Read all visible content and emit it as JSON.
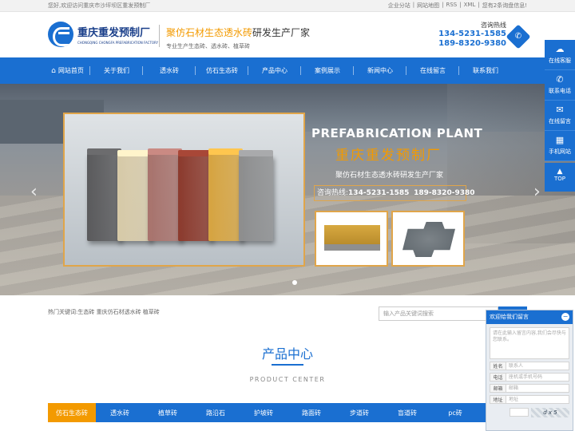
{
  "topbar": {
    "welcome": "您好,欢迎访问重庆市沙坪坝区重发预制厂",
    "links": [
      "企业分站",
      "|",
      "网站地图",
      "|",
      "RSS",
      "|",
      "XML",
      "|",
      "您有2条询盘信息!"
    ]
  },
  "header": {
    "logo_cn": "重庆重发预制厂",
    "logo_en": "CHONGQING CHONGFA PREFABRICATION FACTORY",
    "slogan_hl": "聚仿石材生态透水砖",
    "slogan_rest": "研发生产厂家",
    "slogan_sub": "专业生产生态砖、透水砖、植草砖",
    "hotline_title": "咨询热线",
    "hotline_1": "134-5231-1585",
    "hotline_2": "189-8320-9380",
    "phone_icon": "phone-icon"
  },
  "nav": {
    "items": [
      {
        "label": "网站首页"
      },
      {
        "label": "关于我们"
      },
      {
        "label": "透水砖"
      },
      {
        "label": "仿石生态砖"
      },
      {
        "label": "产品中心"
      },
      {
        "label": "案例展示"
      },
      {
        "label": "新闻中心"
      },
      {
        "label": "在线留言"
      },
      {
        "label": "联系我们"
      }
    ]
  },
  "banner": {
    "title_en": "PREFABRICATION PLANT",
    "title_cn": "重庆重发预制厂",
    "subtitle": "聚仿石材生态透水砖研发生产厂家",
    "phone_label": "咨询热线:",
    "phone_1": "134-5231-1585",
    "phone_2": "189-8320-9380",
    "prev": "‹",
    "next": "›",
    "brick_colors": [
      "#5a5a5c",
      "#d8cba9",
      "#a8736d",
      "#8c3b2e",
      "#d7a542",
      "#8d8e8f"
    ]
  },
  "search": {
    "hot_keywords": "热门关键词:生态砖 重庆仿石材透水砖 植草砖",
    "placeholder": "输入产品关键词搜索"
  },
  "products": {
    "title": "产品中心",
    "title_en": "PRODUCT CENTER",
    "tabs": [
      "仿石生态砖",
      "透水砖",
      "植草砖",
      "路沿石",
      "护坡砖",
      "路面砖",
      "步道砖",
      "盲道砖",
      "pc砖",
      "..."
    ]
  },
  "side": {
    "items": [
      "在线客服",
      "联系电话",
      "在线留言",
      "手机网站"
    ],
    "top": "TOP"
  },
  "message": {
    "title": "欢迎给我们留言",
    "close": "−",
    "content_placeholder": "请在此输入留言内容,我们会尽快与您联系。",
    "name_label": "姓名",
    "name_placeholder": "联系人",
    "phone_label": "电话",
    "phone_placeholder": "座机或手机号码",
    "email_label": "邮箱",
    "email_placeholder": "邮箱",
    "address_label": "地址",
    "address_placeholder": "地址",
    "captcha_text": "d x 5"
  }
}
